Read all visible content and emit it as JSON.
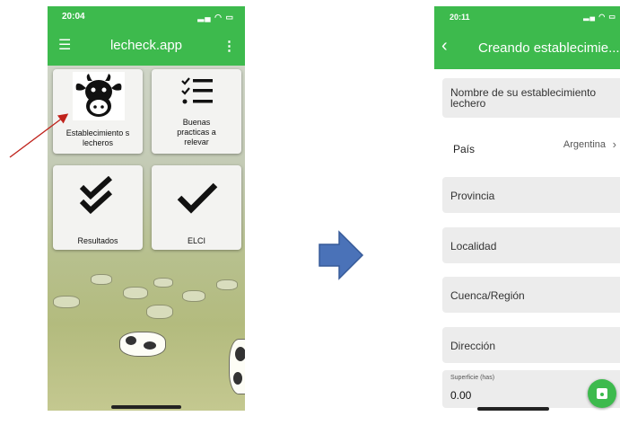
{
  "left_phone": {
    "status": {
      "time": "20:04",
      "indicators": "signal-wifi-battery"
    },
    "appbar": {
      "title": "lecheck.app",
      "menu_icon": "menu-icon",
      "more_icon": "more-vert-icon"
    },
    "tiles": [
      {
        "label": "Establecimiento s lecheros",
        "icon": "cow-icon"
      },
      {
        "label": "Buenas practicas a relevar",
        "icon": "checklist-icon"
      },
      {
        "label": "Resultados",
        "icon": "double-check-icon"
      },
      {
        "label": "ELCI",
        "icon": "check-icon"
      }
    ]
  },
  "right_phone": {
    "status": {
      "time": "20:11",
      "indicators": "signal-wifi-battery"
    },
    "appbar": {
      "title": "Creando establecimie...",
      "back_icon": "chevron-left-icon"
    },
    "form": {
      "nombre_placeholder": "Nombre de su establecimiento lechero",
      "pais_label": "País",
      "pais_value": "Argentina",
      "provincia_placeholder": "Provincia",
      "localidad_placeholder": "Localidad",
      "cuenca_placeholder": "Cuenca/Región",
      "direccion_placeholder": "Dirección",
      "superficie_label": "Superficie (has)",
      "superficie_value": "0.00"
    },
    "fab_icon": "save-icon"
  },
  "colors": {
    "brand_green": "#3dba4d",
    "arrow_blue": "#4a72b8",
    "annotation_red": "#c0221b"
  }
}
